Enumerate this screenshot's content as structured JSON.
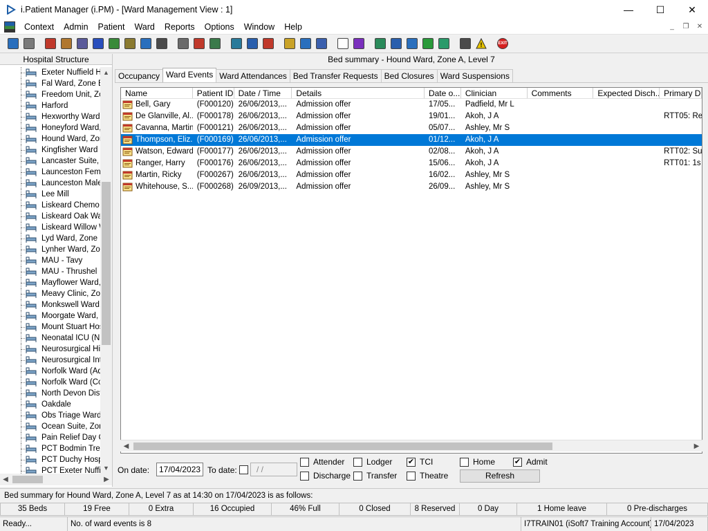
{
  "window": {
    "title": "i.Patient Manager (i.PM) - [Ward Management View : 1]",
    "minimize": "—",
    "maximize": "☐",
    "close": "✕"
  },
  "menu": {
    "items": [
      "Context",
      "Admin",
      "Patient",
      "Ward",
      "Reports",
      "Options",
      "Window",
      "Help"
    ],
    "mdi": [
      "_",
      "❐",
      "✕"
    ]
  },
  "toolbar": {
    "icons": [
      {
        "name": "person-icon",
        "color": "#2a6fbd"
      },
      {
        "name": "print-icon",
        "color": "#7a7a7a"
      },
      {
        "name": "book-red-icon",
        "color": "#c0392b"
      },
      {
        "name": "notes-icon",
        "color": "#b0772f"
      },
      {
        "name": "list-icon",
        "color": "#5a5a9a"
      },
      {
        "name": "mail-m-icon",
        "color": "#2a4fbd"
      },
      {
        "name": "doctor-icon",
        "color": "#3a8a3a"
      },
      {
        "name": "form-icon",
        "color": "#8a7a30"
      },
      {
        "name": "bed-flag-icon",
        "color": "#2a6fbd"
      },
      {
        "name": "bed-icon",
        "color": "#4a4a4a"
      },
      {
        "name": "magnify-bed-icon",
        "color": "#6a6a6a"
      },
      {
        "name": "clock-icon",
        "color": "#c0392b"
      },
      {
        "name": "monitor-icon",
        "color": "#3a7a4a"
      },
      {
        "name": "screen-icon",
        "color": "#2a7a9a"
      },
      {
        "name": "window-icon",
        "color": "#2a5fad"
      },
      {
        "name": "no-entry-icon",
        "color": "#c0392b"
      },
      {
        "name": "notepad-icon",
        "color": "#c9a227"
      },
      {
        "name": "bed-transfer-icon",
        "color": "#2a6fbd"
      },
      {
        "name": "person-bed-icon",
        "color": "#3a5fad"
      },
      {
        "name": "document-icon",
        "color": "#ffffff"
      },
      {
        "name": "bar-chart-icon",
        "color": "#7a2fbd"
      },
      {
        "name": "globe-icon",
        "color": "#2a8a5a"
      },
      {
        "name": "check-down-icon",
        "color": "#2a5fad"
      },
      {
        "name": "check-list-icon",
        "color": "#2a6fbd"
      },
      {
        "name": "green-arrow-icon",
        "color": "#2a9a3a"
      },
      {
        "name": "swap-green-icon",
        "color": "#2a9a6a"
      },
      {
        "name": "swap-arrows-icon",
        "color": "#4a4a4a"
      },
      {
        "name": "warning-icon",
        "color": "#e8c400"
      },
      {
        "name": "exit-icon",
        "color": "#d62020"
      }
    ],
    "exit_label": "EXIT"
  },
  "left_panel": {
    "header": "Hospital Structure",
    "items": [
      "Exeter Nuffield Hosp",
      "Fal Ward, Zone E",
      "Freedom Unit, Zone",
      "Harford",
      "Hexworthy Ward, Zo",
      "Honeyford Ward, Zo",
      "Hound Ward, Zone A",
      "Kingfisher Ward",
      "Lancaster Suite, Zo",
      "Launceston Female",
      "Launceston Male",
      "Lee Mill",
      "Liskeard Chemo Day",
      "Liskeard Oak Ward",
      "Liskeard Willow Wa",
      "Lyd Ward, Zone D",
      "Lynher Ward, Zone",
      "MAU - Tavy",
      "MAU - Thrushel",
      "Mayflower Ward, Zo",
      "Meavy Clinic, Zone",
      "Monkswell Ward, Zo",
      "Moorgate Ward, Zo",
      "Mount Stuart Hospit",
      "Neonatal ICU (NNU)",
      "Neurosurgical High",
      "Neurosurgical Inten",
      "Norfolk Ward (Adult",
      "Norfolk Ward (Com",
      "North Devon Distri",
      "Oakdale",
      "Obs Triage Ward",
      "Ocean Suite, Zone",
      "Pain Relief Day Ca",
      "PCT Bodmin Treat",
      "PCT Duchy Hospit",
      "PCT Exeter Nuffie"
    ]
  },
  "bed_summary": "Bed summary - Hound Ward, Zone A, Level 7",
  "tabs": [
    "Occupancy",
    "Ward Events",
    "Ward Attendances",
    "Bed Transfer Requests",
    "Bed Closures",
    "Ward Suspensions"
  ],
  "active_tab": 1,
  "grid": {
    "columns": [
      "Name",
      "Patient ID",
      "Date / Time",
      "Details",
      "Date o...",
      "Clinician",
      "Comments",
      "Expected Disch...",
      "Primary Dia"
    ],
    "rows": [
      [
        "Bell, Gary",
        "(F000120)",
        "26/06/2013,...",
        "Admission offer",
        "17/05...",
        "Padfield, Mr L",
        "",
        "",
        ""
      ],
      [
        "De Glanville, Al...",
        "(F000178)",
        "26/06/2013,...",
        "Admission offer",
        "19/01...",
        "Akoh, J A",
        "",
        "",
        "RTT05: Re"
      ],
      [
        "Cavanna, Martin",
        "(F000121)",
        "26/06/2013,...",
        "Admission offer",
        "05/07...",
        "Ashley, Mr S",
        "",
        "",
        ""
      ],
      [
        "Thompson, Eliz...",
        "(F000169)",
        "26/06/2013,...",
        "Admission offer",
        "01/12...",
        "Akoh, J A",
        "",
        "",
        ""
      ],
      [
        "Watson, Edward",
        "(F000177)",
        "26/06/2013,...",
        "Admission offer",
        "02/08...",
        "Akoh, J A",
        "",
        "",
        "RTT02: Su"
      ],
      [
        "Ranger, Harry",
        "(F000176)",
        "26/06/2013,...",
        "Admission offer",
        "15/06...",
        "Akoh, J A",
        "",
        "",
        "RTT01: 1s"
      ],
      [
        "Martin, Ricky",
        "(F000267)",
        "26/06/2013,...",
        "Admission offer",
        "16/02...",
        "Ashley, Mr S",
        "",
        "",
        ""
      ],
      [
        "Whitehouse, S...",
        "(F000268)",
        "26/09/2013,...",
        "Admission offer",
        "26/09...",
        "Ashley, Mr S",
        "",
        "",
        ""
      ]
    ],
    "selected_row": 3
  },
  "filters": {
    "on_date_label": "On date:",
    "on_date_value": "17/04/2023",
    "to_date_label": "To date:",
    "to_date_value": "/ /",
    "checkboxes": {
      "attender": {
        "label": "Attender",
        "checked": false
      },
      "lodger": {
        "label": "Lodger",
        "checked": false
      },
      "tci": {
        "label": "TCI",
        "checked": true
      },
      "home": {
        "label": "Home",
        "checked": false
      },
      "admit": {
        "label": "Admit",
        "checked": true
      },
      "discharge": {
        "label": "Discharge",
        "checked": false
      },
      "transfer": {
        "label": "Transfer",
        "checked": false
      },
      "theatre": {
        "label": "Theatre",
        "checked": false
      }
    },
    "refresh_label": "Refresh"
  },
  "status_message": "Bed summary for Hound Ward, Zone A, Level 7 as at 14:30 on 17/04/2023 is as follows:",
  "stats": [
    "35 Beds",
    "19 Free",
    "0 Extra",
    "16 Occupied",
    "46% Full",
    "0 Closed",
    "8 Reserved",
    "0 Day",
    "1 Home leave",
    "0 Pre-discharges"
  ],
  "statusbar": {
    "ready": "Ready...",
    "events": "No. of ward events is 8",
    "user": "I7TRAIN01 (iSoft7 Training Account)",
    "date": "17/04/2023"
  },
  "colors": {
    "selection": "#0078d7",
    "exit_red": "#d62020"
  }
}
